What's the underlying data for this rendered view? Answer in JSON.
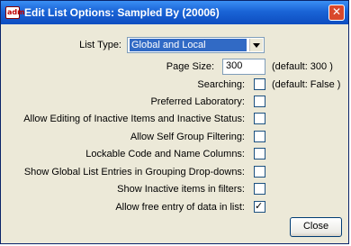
{
  "window": {
    "title": "Edit List Options: Sampled By (20006)",
    "app_icon_text": "adm",
    "close_glyph": "✕"
  },
  "form": {
    "list_type": {
      "label": "List Type:",
      "value": "Global and Local"
    },
    "page_size": {
      "label": "Page Size:",
      "value": "300",
      "default": "(default: 300   )"
    },
    "options": [
      {
        "label": "Searching:",
        "checked": false,
        "default": "(default: False )"
      },
      {
        "label": "Preferred Laboratory:",
        "checked": false
      },
      {
        "label": "Allow Editing of Inactive Items and Inactive Status:",
        "checked": false
      },
      {
        "label": "Allow Self Group Filtering:",
        "checked": false
      },
      {
        "label": "Lockable Code and Name Columns:",
        "checked": false
      },
      {
        "label": "Show Global List Entries in Grouping Drop-downs:",
        "checked": false
      },
      {
        "label": "Show Inactive items in filters:",
        "checked": false
      },
      {
        "label": "Allow free entry of data in list:",
        "checked": true
      }
    ],
    "check_glyph": "✓"
  },
  "buttons": {
    "close_label": "Close"
  }
}
